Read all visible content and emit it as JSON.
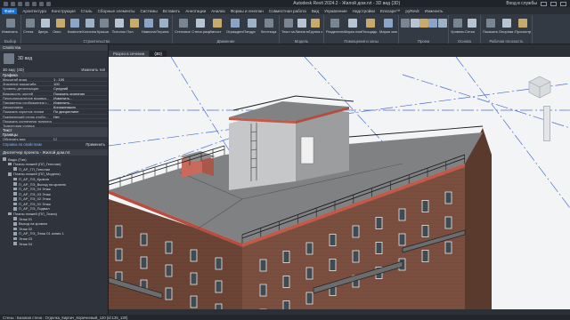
{
  "titlebar": {
    "title": "Autodesk Revit 2024.2 - Жилой дом.rvt - 3D вид {3D}",
    "user": "Вход в службы"
  },
  "menubar": {
    "tabs": [
      "Файл",
      "Архитектура",
      "Конструкция",
      "Сталь",
      "Сборные элементы",
      "Системы",
      "Вставить",
      "Аннотации",
      "Анализ",
      "Формы и генплан",
      "Совместная работа",
      "Вид",
      "Управление",
      "Надстройки",
      "Enscape™",
      "pyRevit",
      "Изменить"
    ]
  },
  "ribbon": {
    "groups": [
      {
        "label": "Выбор",
        "buttons": [
          "Изменить"
        ]
      },
      {
        "label": "Строительство",
        "buttons": [
          "Стена",
          "Дверь",
          "Окно",
          "Компонент",
          "Колонна",
          "Крыша",
          "Потолок",
          "Пол",
          "Навесная стена",
          "Перила"
        ]
      },
      {
        "label": "Движение",
        "buttons": [
          "Стеновое ограждение",
          "Стена разреза",
          "Импост",
          "Ограждение",
          "Пандус",
          "Лестница"
        ]
      },
      {
        "label": "Модель",
        "buttons": [
          "Текст модели",
          "Линия модели",
          "Группа модели"
        ]
      },
      {
        "label": "Помещения и зоны",
        "buttons": [
          "Разделитель помещений",
          "Марка помещения",
          "Площадь",
          "Марка зоны"
        ]
      },
      {
        "label": "Проем",
        "buttons": [
          "По грани",
          "Шахта",
          "Стена",
          "Вертикаль",
          "Слуховое окно"
        ]
      },
      {
        "label": "Основа",
        "buttons": [
          "Уровень",
          "Сетка"
        ]
      },
      {
        "label": "Рабочая плоскость",
        "buttons": [
          "Показать",
          "Опорная плоскость",
          "Просмотр"
        ]
      }
    ]
  },
  "properties": {
    "header": "Свойства",
    "type_name": "3D вид",
    "selector": "3D вид: {3D}",
    "edit_type": "Изменить тип",
    "section_graphics": "Графика",
    "rows": [
      [
        "Масштаб вида",
        "1 : 100"
      ],
      [
        "Значение масштаба",
        "100"
      ],
      [
        "Уровень детализации",
        "Средний"
      ],
      [
        "Видимость частей",
        "Показать оригинал"
      ],
      [
        "Переопределение видимо...",
        "Изменить..."
      ],
      [
        "Параметры отображения г...",
        "Изменить..."
      ],
      [
        "Дисциплина",
        "Координация"
      ],
      [
        "Показать скрытые линии",
        "По дисциплине"
      ],
      [
        "Графический стиль отобр...",
        "Нет"
      ],
      [
        "Показать солнечную траекторию",
        ""
      ],
      [
        "Траектория солнца",
        ""
      ]
    ],
    "section_text": "Текст",
    "section_extents": "Границы",
    "crop_label": "Обрезать вид",
    "help_link": "Справка по свойствам",
    "apply": "Применить"
  },
  "browser": {
    "header": "Диспетчер проекта - Жилой дом.rvt",
    "items": [
      "Виды (Тип)",
      "Планы этажей (ПЛ_Генплан)",
      "П_АР_ГП_Генплан",
      "Планы этажей (ПЛ_Модели)",
      "П_АР_ПЭ_Кровля",
      "П_АР_ПЭ_Выход на кровлю",
      "П_АР_ПЭ_04 Этаж",
      "П_АР_ПЭ_03 Этаж",
      "П_АР_ПЭ_02 Этаж",
      "П_АР_ПЭ_01 Этаж",
      "П_АР_ПЭ_Подвал",
      "Планы этажей (ПЛ_Эскиз)",
      "Этаж 01",
      "Выход на кровлю",
      "Этаж 02",
      "П_АР_ПЭ_Этаж 01 копия 1",
      "Этаж 03",
      "Этаж 04"
    ]
  },
  "viewtabs": [
    "Разрез в сечении",
    "{3D}"
  ],
  "statusbar": {
    "text": "Стены : Базовая стена : Отделка_Кирпич_Коричневый_120 (id:135_130)"
  },
  "colors": {
    "accent": "#1a6fc9",
    "brick": "#6e4536",
    "parapet": "#c25a4a",
    "roof": "#8a8c8e"
  }
}
